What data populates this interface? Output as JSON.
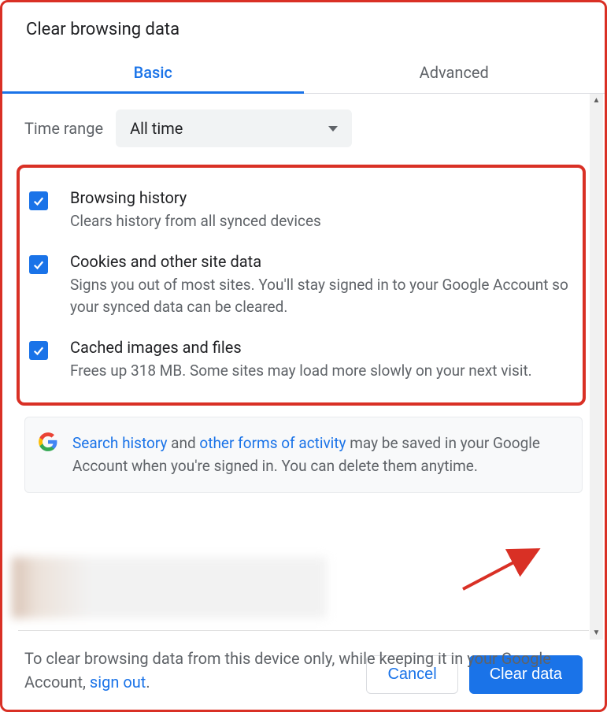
{
  "dialog": {
    "title": "Clear browsing data",
    "tabs": {
      "basic": "Basic",
      "advanced": "Advanced"
    },
    "time_label": "Time range",
    "time_value": "All time",
    "options": [
      {
        "title": "Browsing history",
        "desc": "Clears history from all synced devices"
      },
      {
        "title": "Cookies and other site data",
        "desc": "Signs you out of most sites. You'll stay signed in to your Google Account so your synced data can be cleared."
      },
      {
        "title": "Cached images and files",
        "desc": "Frees up 318 MB. Some sites may load more slowly on your next visit."
      }
    ],
    "info": {
      "link1": "Search history",
      "mid1": " and ",
      "link2": "other forms of activity",
      "rest": " may be saved in your Google Account when you're signed in. You can delete them anytime."
    },
    "buttons": {
      "cancel": "Cancel",
      "clear": "Clear data"
    },
    "footer": {
      "text": "To clear browsing data from this device only, while keeping it in your Google Account, ",
      "link": "sign out",
      "period": "."
    }
  }
}
